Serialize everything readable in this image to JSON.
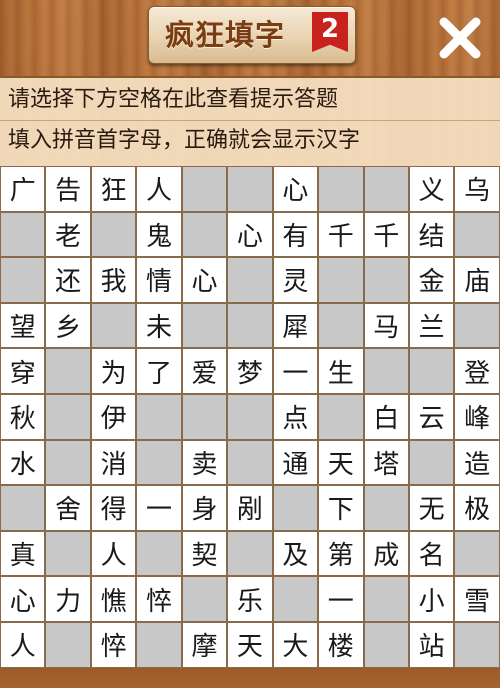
{
  "header": {
    "title": "疯狂填字",
    "level": "2",
    "close_icon": "close-x-icon"
  },
  "hint": {
    "line1": "请选择下方空格在此查看提示答题",
    "line2": "填入拼音首字母，正确就会显示汉字"
  },
  "grid": {
    "rows": [
      [
        "广",
        "告",
        "狂",
        "人",
        "#",
        "#",
        "心",
        "#",
        "#",
        "义",
        "乌"
      ],
      [
        "#",
        "老",
        "#",
        "鬼",
        "#",
        "心",
        "有",
        "千",
        "千",
        "结",
        "#"
      ],
      [
        "#",
        "还",
        "我",
        "情",
        "心",
        "#",
        "灵",
        "#",
        "#",
        "金",
        "庙"
      ],
      [
        "望",
        "乡",
        "#",
        "未",
        "#",
        "#",
        "犀",
        "#",
        "马",
        "兰",
        "#"
      ],
      [
        "穿",
        "#",
        "为",
        "了",
        "爱",
        "梦",
        "一",
        "生",
        "#",
        "#",
        "登"
      ],
      [
        "秋",
        "#",
        "伊",
        "#",
        "#",
        "#",
        "点",
        "#",
        "白",
        "云",
        "峰"
      ],
      [
        "水",
        "#",
        "消",
        "#",
        "卖",
        "#",
        "通",
        "天",
        "塔",
        "#",
        "造"
      ],
      [
        "#",
        "舍",
        "得",
        "一",
        "身",
        "剐",
        "#",
        "下",
        "#",
        "无",
        "极"
      ],
      [
        "真",
        "#",
        "人",
        "#",
        "契",
        "#",
        "及",
        "第",
        "成",
        "名",
        "#"
      ],
      [
        "心",
        "力",
        "憔",
        "悴",
        "#",
        "乐",
        "#",
        "一",
        "#",
        "小",
        "雪"
      ],
      [
        "人",
        "#",
        "悴",
        "#",
        "摩",
        "天",
        "大",
        "楼",
        "#",
        "站",
        "#"
      ]
    ]
  }
}
